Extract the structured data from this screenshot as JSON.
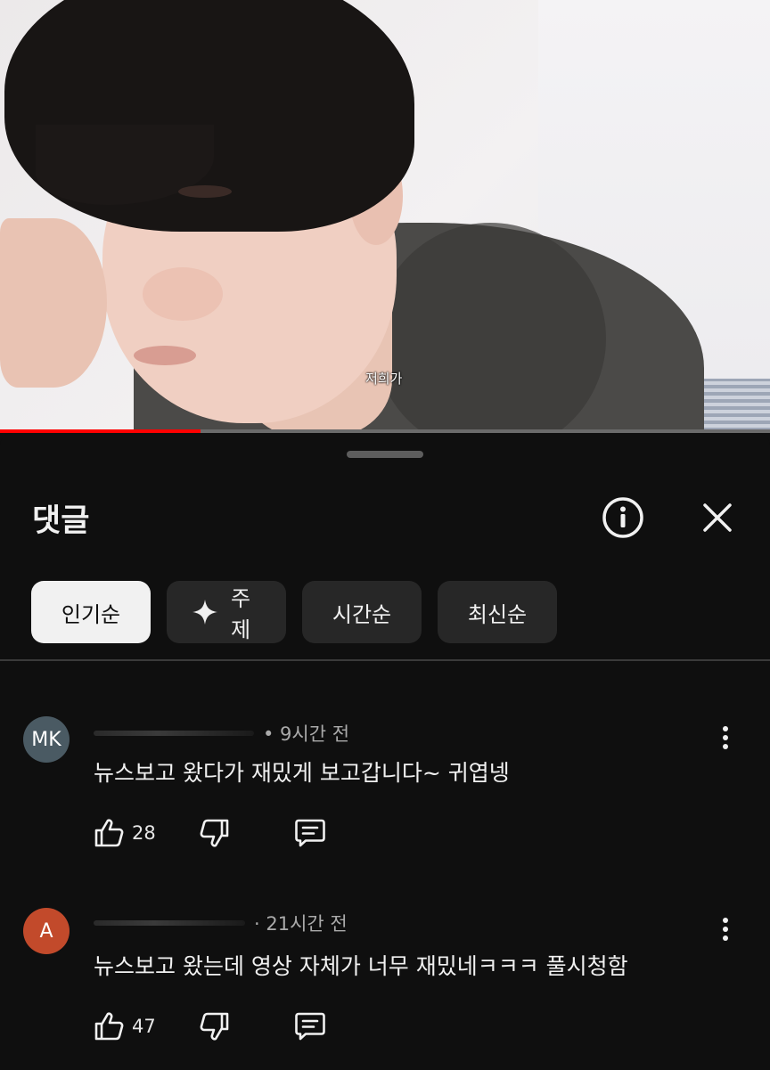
{
  "video": {
    "caption": "저희가",
    "watermark": "",
    "progress_fraction": 0.26
  },
  "panel": {
    "title": "댓글",
    "icons": {
      "info": "info-icon",
      "close": "close-icon"
    }
  },
  "sort_chips": [
    {
      "label": "인기순",
      "active": true
    },
    {
      "label": "주제",
      "active": false,
      "icon": "sparkle-icon"
    },
    {
      "label": "시간순",
      "active": false
    },
    {
      "label": "최신순",
      "active": false
    }
  ],
  "comments": [
    {
      "avatar_initials": "MK",
      "avatar_color": "#4a5a63",
      "time": "• 9시간 전",
      "text": "뉴스보고 왔다가 재밌게 보고갑니다~ 귀엽넹",
      "likes": "28"
    },
    {
      "avatar_initials": "A",
      "avatar_color": "#c24a2b",
      "time": "· 21시간 전",
      "text": "뉴스보고 왔는데 영상 자체가 너무 재밌네ㅋㅋㅋ 풀시청함",
      "likes": "47"
    }
  ],
  "colors": {
    "background": "#0f0f0f",
    "chip": "#272727",
    "chip_active": "#f1f1f1",
    "progress": "#ff0000"
  }
}
